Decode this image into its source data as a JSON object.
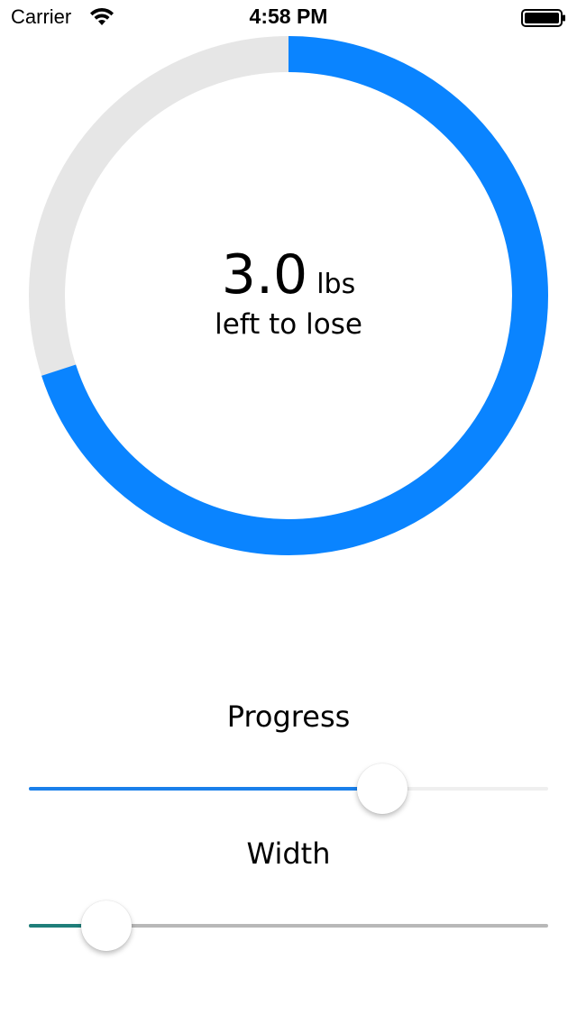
{
  "status_bar": {
    "carrier": "Carrier",
    "time": "4:58 PM",
    "battery_icon": "battery-full-icon",
    "wifi_icon": "wifi-icon"
  },
  "ring": {
    "progress": 0.7,
    "progress_color": "#0A84FF",
    "track_color": "#E6E6E6"
  },
  "display": {
    "value": "3.0",
    "unit": "lbs",
    "caption": "left to lose"
  },
  "controls": {
    "progress": {
      "label": "Progress",
      "value": 0.68,
      "fill_color": "#1A7FEA",
      "track_color": "#EFEFEF"
    },
    "width": {
      "label": "Width",
      "value": 0.15,
      "fill_color": "#1F7E7A",
      "track_color": "#B8B8B8"
    }
  }
}
